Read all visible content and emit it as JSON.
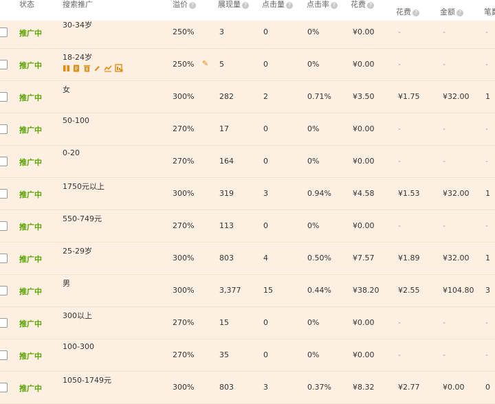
{
  "header": {
    "status": "状态",
    "search_promo": "搜索推广",
    "premium": "溢价",
    "impressions": "展现量",
    "clicks": "点击量",
    "ctr": "点击率",
    "cost": "花费",
    "sub_cost": "花费",
    "amount": "金额",
    "orders": "笔数"
  },
  "rows": [
    {
      "status": "推广中",
      "name": "30-34岁",
      "premium": "250%",
      "imp": "3",
      "clicks": "0",
      "ctr": "0%",
      "cost": "¥0.00",
      "cost2": "-",
      "amount": "-",
      "orders": "-"
    },
    {
      "status": "推广中",
      "name": "18-24岁",
      "premium": "250%",
      "imp": "5",
      "clicks": "0",
      "ctr": "0%",
      "cost": "¥0.00",
      "cost2": "-",
      "amount": "-",
      "orders": "-"
    },
    {
      "status": "推广中",
      "name": "女",
      "premium": "300%",
      "imp": "282",
      "clicks": "2",
      "ctr": "0.71%",
      "cost": "¥3.50",
      "cost2": "¥1.75",
      "amount": "¥32.00",
      "orders": "1"
    },
    {
      "status": "推广中",
      "name": "50-100",
      "premium": "270%",
      "imp": "17",
      "clicks": "0",
      "ctr": "0%",
      "cost": "¥0.00",
      "cost2": "-",
      "amount": "-",
      "orders": "-"
    },
    {
      "status": "推广中",
      "name": "0-20",
      "premium": "270%",
      "imp": "164",
      "clicks": "0",
      "ctr": "0%",
      "cost": "¥0.00",
      "cost2": "-",
      "amount": "-",
      "orders": "-"
    },
    {
      "status": "推广中",
      "name": "1750元以上",
      "premium": "300%",
      "imp": "319",
      "clicks": "3",
      "ctr": "0.94%",
      "cost": "¥4.58",
      "cost2": "¥1.53",
      "amount": "¥32.00",
      "orders": "1"
    },
    {
      "status": "推广中",
      "name": "550-749元",
      "premium": "270%",
      "imp": "113",
      "clicks": "0",
      "ctr": "0%",
      "cost": "¥0.00",
      "cost2": "-",
      "amount": "-",
      "orders": "-"
    },
    {
      "status": "推广中",
      "name": "25-29岁",
      "premium": "300%",
      "imp": "803",
      "clicks": "4",
      "ctr": "0.50%",
      "cost": "¥7.57",
      "cost2": "¥1.89",
      "amount": "¥32.00",
      "orders": "1"
    },
    {
      "status": "推广中",
      "name": "男",
      "premium": "300%",
      "imp": "3,377",
      "clicks": "15",
      "ctr": "0.44%",
      "cost": "¥38.20",
      "cost2": "¥2.55",
      "amount": "¥104.80",
      "orders": "3"
    },
    {
      "status": "推广中",
      "name": "300以上",
      "premium": "270%",
      "imp": "15",
      "clicks": "0",
      "ctr": "0%",
      "cost": "¥0.00",
      "cost2": "-",
      "amount": "-",
      "orders": "-"
    },
    {
      "status": "推广中",
      "name": "100-300",
      "premium": "270%",
      "imp": "35",
      "clicks": "0",
      "ctr": "0%",
      "cost": "¥0.00",
      "cost2": "-",
      "amount": "-",
      "orders": "-"
    },
    {
      "status": "推广中",
      "name": "1050-1749元",
      "premium": "300%",
      "imp": "803",
      "clicks": "3",
      "ctr": "0.37%",
      "cost": "¥8.32",
      "cost2": "¥2.77",
      "amount": "¥0.00",
      "orders": "0"
    }
  ],
  "colors": {
    "status": "#5aa400",
    "action": "#e8880c",
    "row_bg": "#fdf0e2"
  },
  "row_actions": [
    "pause-icon",
    "copy-icon",
    "delete-icon",
    "edit-icon",
    "trend-chart-icon",
    "report-icon"
  ]
}
